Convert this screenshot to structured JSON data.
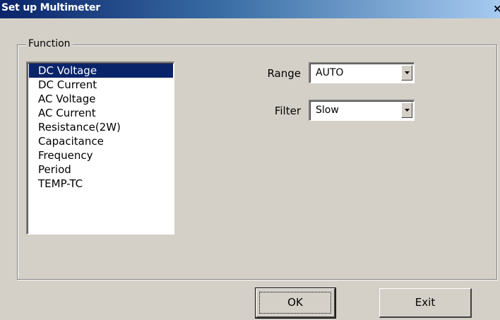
{
  "window": {
    "title": "Set up Multimeter",
    "close_glyph": "×",
    "close_icon": "close-icon"
  },
  "function_group": {
    "legend": "Function",
    "items": [
      {
        "label": "DC Voltage",
        "selected": true
      },
      {
        "label": "DC Current",
        "selected": false
      },
      {
        "label": "AC Voltage",
        "selected": false
      },
      {
        "label": "AC Current",
        "selected": false
      },
      {
        "label": "Resistance(2W)",
        "selected": false
      },
      {
        "label": "Capacitance",
        "selected": false
      },
      {
        "label": "Frequency",
        "selected": false
      },
      {
        "label": "Period",
        "selected": false
      },
      {
        "label": "TEMP-TC",
        "selected": false
      }
    ]
  },
  "range": {
    "label": "Range",
    "value": "AUTO",
    "arrow_icon": "chevron-down-icon"
  },
  "filter": {
    "label": "Filter",
    "value": "Slow",
    "arrow_icon": "chevron-down-icon"
  },
  "buttons": {
    "ok_label": "OK",
    "exit_label": "Exit"
  },
  "colors": {
    "selection": "#0a246a",
    "window_face": "#d4d0c8",
    "titlebar_start": "#0a246a",
    "titlebar_end": "#a6caf0"
  }
}
